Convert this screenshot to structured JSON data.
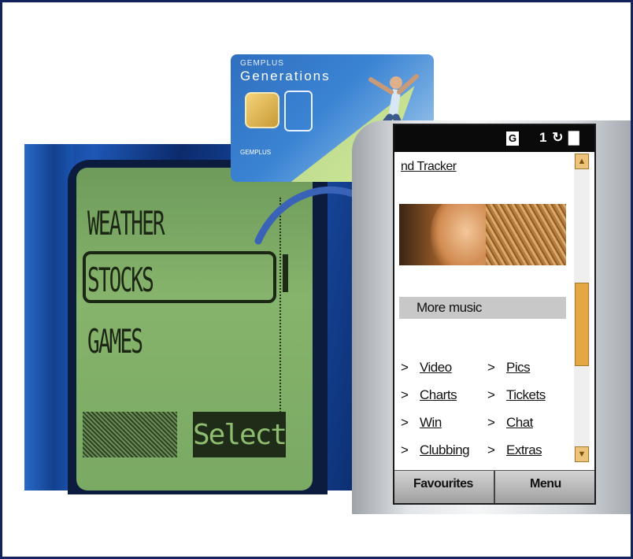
{
  "feature_phone": {
    "menu_items": [
      "WEATHER",
      "STOCKS",
      "GAMES"
    ],
    "selected_item": "STOCKS",
    "right_softkey": "Select"
  },
  "sim_card": {
    "brand_small": "GEMPLUS",
    "brand": "Generations",
    "maker": "GEMPLUS"
  },
  "smartphone": {
    "status": {
      "network_indicator": "G",
      "line_number": "1"
    },
    "header_link": "nd Tracker",
    "more_label": "More music",
    "links_left": [
      "Video",
      "Charts",
      "Win",
      "Clubbing"
    ],
    "links_right": [
      "Pics",
      "Tickets",
      "Chat",
      "Extras"
    ],
    "chevron": ">",
    "softkeys": {
      "left": "Favourites",
      "right": "Menu"
    }
  },
  "colors": {
    "frame_border": "#13235e",
    "lcd_green": "#86b46c",
    "arrow_blue": "#3a63b8",
    "scroll_orange": "#e3a844"
  }
}
